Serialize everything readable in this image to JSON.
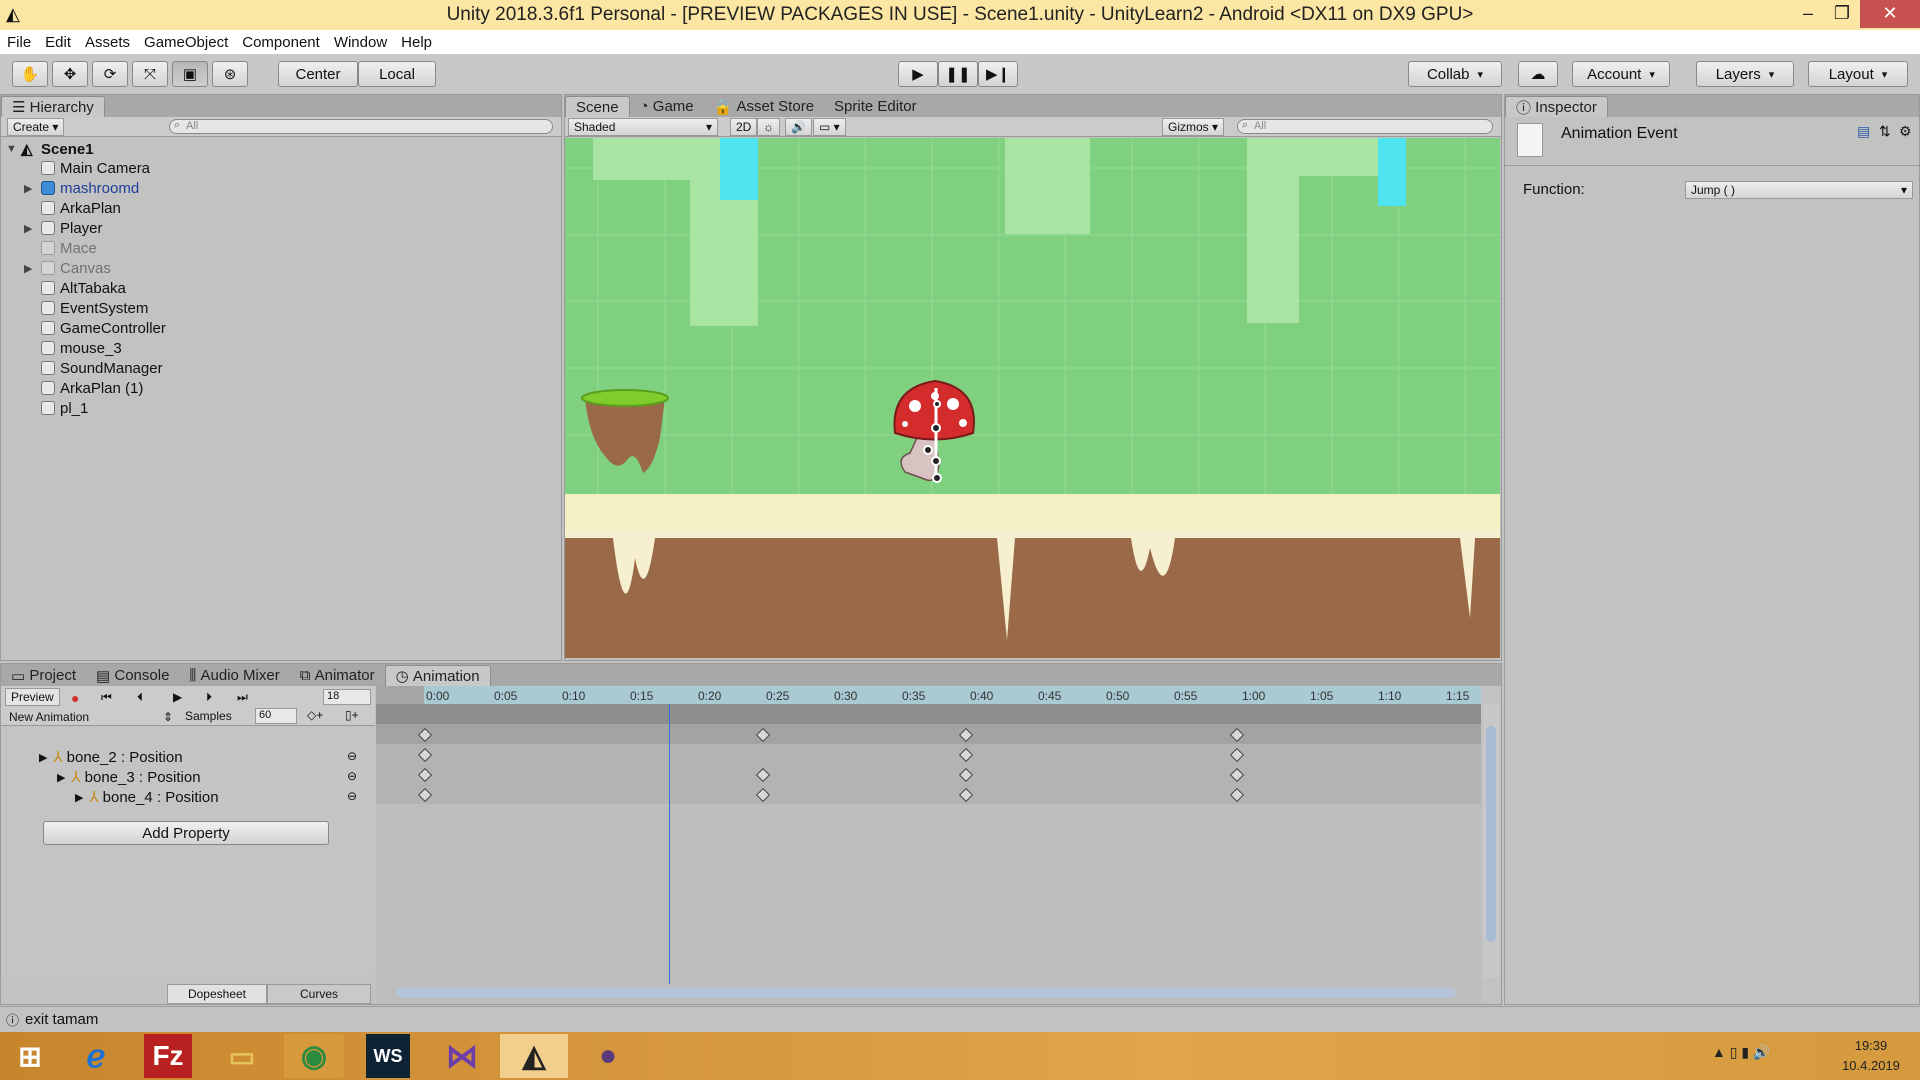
{
  "window": {
    "title": "Unity 2018.3.6f1 Personal - [PREVIEW PACKAGES IN USE] - Scene1.unity - UnityLearn2 - Android <DX11 on DX9 GPU>",
    "minimize": "–",
    "maximize": "❐",
    "close": "✕"
  },
  "menu": [
    "File",
    "Edit",
    "Assets",
    "GameObject",
    "Component",
    "Window",
    "Help"
  ],
  "toolbar": {
    "center": "Center",
    "local": "Local",
    "collab": "Collab",
    "account": "Account",
    "layers": "Layers",
    "layout": "Layout"
  },
  "hierarchy": {
    "tab": "Hierarchy",
    "create": "Create",
    "search_placeholder": "All",
    "scene": "Scene1",
    "items": [
      "Main Camera",
      "mashroomd",
      "ArkaPlan",
      "Player",
      "Mace",
      "Canvas",
      "AltTabaka",
      "EventSystem",
      "GameController",
      "mouse_3",
      "SoundManager",
      "ArkaPlan (1)",
      "pl_1"
    ]
  },
  "scene": {
    "tabs": [
      "Scene",
      "Game",
      "Asset Store",
      "Sprite Editor"
    ],
    "shading": "Shaded",
    "mode2d": "2D",
    "gizmos": "Gizmos",
    "search_placeholder": "All"
  },
  "inspector": {
    "tab": "Inspector",
    "title": "Animation Event",
    "function_label": "Function:",
    "function_value": "Jump ( )"
  },
  "bottom": {
    "tabs": [
      "Project",
      "Console",
      "Audio Mixer",
      "Animator",
      "Animation"
    ],
    "preview": "Preview",
    "clip": "New Animation",
    "samples_label": "Samples",
    "samples_value": "60",
    "frame": "18",
    "properties": [
      "bone_2 : Position",
      "bone_3 : Position",
      "bone_4 : Position"
    ],
    "add_property": "Add Property",
    "dopesheet": "Dopesheet",
    "curves": "Curves",
    "ruler": [
      "0:00",
      "0:05",
      "0:10",
      "0:15",
      "0:20",
      "0:25",
      "0:30",
      "0:35",
      "0:40",
      "0:45",
      "0:50",
      "0:55",
      "1:00",
      "1:05",
      "1:10",
      "1:15"
    ]
  },
  "status": {
    "message": "exit tamam"
  },
  "taskbar": {
    "time": "19:39",
    "date": "10.4.2019"
  },
  "colors": {
    "accent_blue": "#3d6dd8",
    "scene_green": "#7fd07f",
    "ground_brown": "#9a6a48",
    "taskbar_orange": "#e0a44a"
  }
}
